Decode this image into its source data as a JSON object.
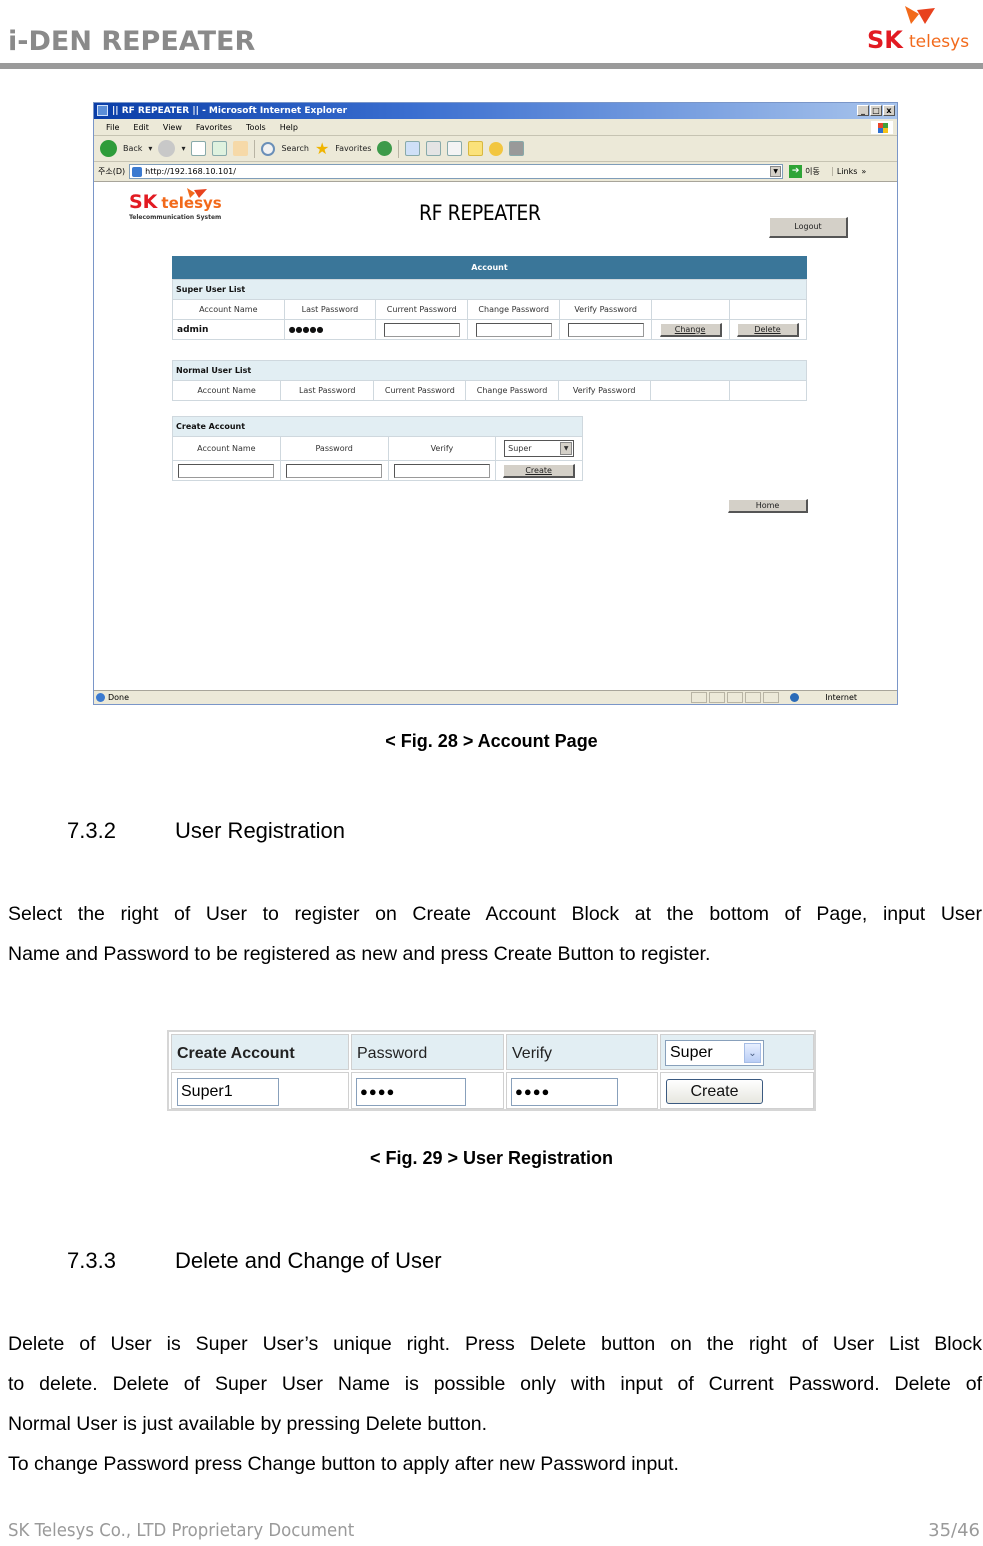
{
  "doc_header": {
    "title": "i-DEN REPEATER",
    "logo": {
      "sk": "SK",
      "telesys": "telesys"
    }
  },
  "fig28": {
    "browser": {
      "window_title": "|| RF REPEATER || - Microsoft Internet Explorer",
      "window_buttons": [
        "_",
        "□",
        "x"
      ],
      "menu": [
        "File",
        "Edit",
        "View",
        "Favorites",
        "Tools",
        "Help"
      ],
      "toolbar": {
        "back": "Back",
        "search": "Search",
        "favorites": "Favorites"
      },
      "address_label": "주소(D)",
      "address_url": "http://192.168.10.101/",
      "go_label": "이동",
      "links_label": "Links",
      "status_text": "Done",
      "status_zone": "Internet"
    },
    "page": {
      "logo": {
        "sk": "SK",
        "telesys": "telesys",
        "subtitle": "Telecommunication System"
      },
      "title": "RF  REPEATER",
      "logout_label": "Logout",
      "account_header": "Account",
      "super_user_list": {
        "title": "Super User List",
        "columns": [
          "Account Name",
          "Last Password",
          "Current Password",
          "Change Password",
          "Verify Password",
          "",
          ""
        ],
        "rows": [
          {
            "account_name": "admin",
            "last_password": "●●●●●",
            "change_label": "Change",
            "delete_label": "Delete"
          }
        ]
      },
      "normal_user_list": {
        "title": "Normal User List",
        "columns": [
          "Account Name",
          "Last Password",
          "Current Password",
          "Change Password",
          "Verify Password",
          "",
          ""
        ]
      },
      "create_account": {
        "title": "Create Account",
        "columns": [
          "Account Name",
          "Password",
          "Verify"
        ],
        "type_selected": "Super",
        "create_label": "Create"
      },
      "home_label": "Home"
    },
    "caption": "< Fig. 28 > Account Page"
  },
  "section_732": {
    "number": "7.3.2",
    "title": "User Registration",
    "paragraph_lines": [
      "Select the right of User to register on Create Account Block at the bottom of Page, input User",
      "Name and Password to be registered as new and press Create Button to register."
    ]
  },
  "fig29": {
    "header": {
      "title": "Create Account",
      "password": "Password",
      "verify": "Verify",
      "type_selected": "Super"
    },
    "row": {
      "account_name": "Super1",
      "password": "●●●●",
      "verify": "●●●●",
      "create_label": "Create"
    },
    "caption": "< Fig. 29 > User Registration"
  },
  "section_733": {
    "number": "7.3.3",
    "title": "Delete and Change of User",
    "paragraph_lines": [
      "Delete of User is Super User’s unique right. Press Delete button on the right of User List Block",
      "to delete. Delete of Super User Name is possible only with input of Current Password. Delete of",
      "Normal User is just available by pressing Delete button.",
      "To change Password press Change button to apply after new Password input."
    ]
  },
  "footer": {
    "left": "SK Telesys Co., LTD Proprietary Document",
    "page": "35/46"
  }
}
